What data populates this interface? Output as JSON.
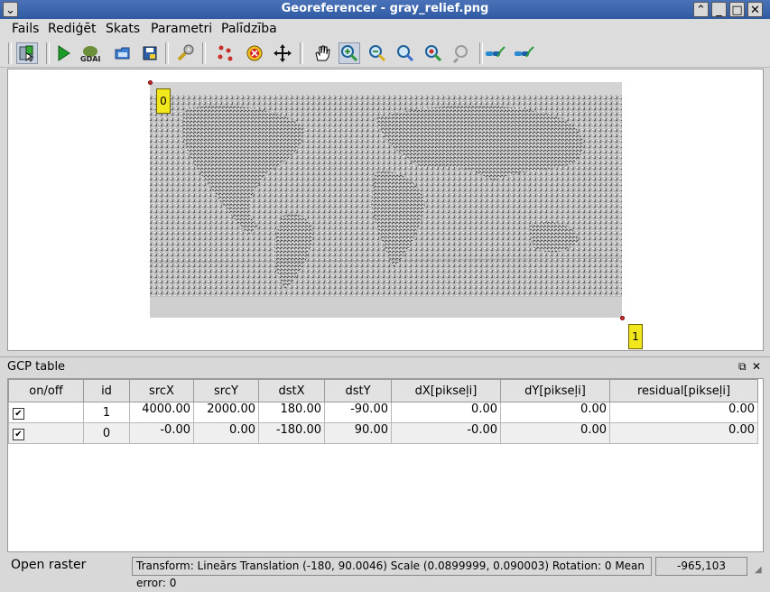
{
  "window": {
    "title": "Georeferencer - gray_relief.png"
  },
  "menu": {
    "items": [
      "Fails",
      "Rediģēt",
      "Skats",
      "Parametri",
      "Palīdzība"
    ]
  },
  "colors": {
    "titlebar": "#2f5aa3",
    "gcp_label": "#f2e61c",
    "gcp_point": "#c8302a"
  },
  "toolbar": {
    "icons": [
      "open-raster-icon",
      "start-georeferencing-icon",
      "gdal-script-icon",
      "load-gcp-icon",
      "save-gcp-icon",
      "settings-icon",
      "add-point-icon",
      "delete-point-icon",
      "move-point-icon",
      "pan-icon",
      "zoom-in-icon",
      "zoom-out-icon",
      "zoom-to-layer-icon",
      "zoom-last-icon",
      "zoom-next-icon",
      "link-georef-icon",
      "link-qgis-icon"
    ]
  },
  "canvas": {
    "gcp_labels": [
      "0",
      "1"
    ]
  },
  "gcp_table": {
    "title": "GCP table",
    "columns": [
      "on/off",
      "id",
      "srcX",
      "srcY",
      "dstX",
      "dstY",
      "dX[pikseļi]",
      "dY[pikseļi]",
      "residual[pikseļi]"
    ],
    "rows": [
      {
        "enabled": true,
        "id": "1",
        "srcX": "4000.00",
        "srcY": "2000.00",
        "dstX": "180.00",
        "dstY": "-90.00",
        "dX": "0.00",
        "dY": "0.00",
        "residual": "0.00"
      },
      {
        "enabled": true,
        "id": "0",
        "srcX": "-0.00",
        "srcY": "0.00",
        "dstX": "-180.00",
        "dstY": "90.00",
        "dX": "-0.00",
        "dY": "0.00",
        "residual": "0.00"
      }
    ]
  },
  "status": {
    "message": "Open raster",
    "transform": "Transform: Lineārs Translation (-180, 90.0046) Scale (0.0899999, 0.090003) Rotation: 0 Mean error: 0",
    "coords": "-965,103"
  }
}
